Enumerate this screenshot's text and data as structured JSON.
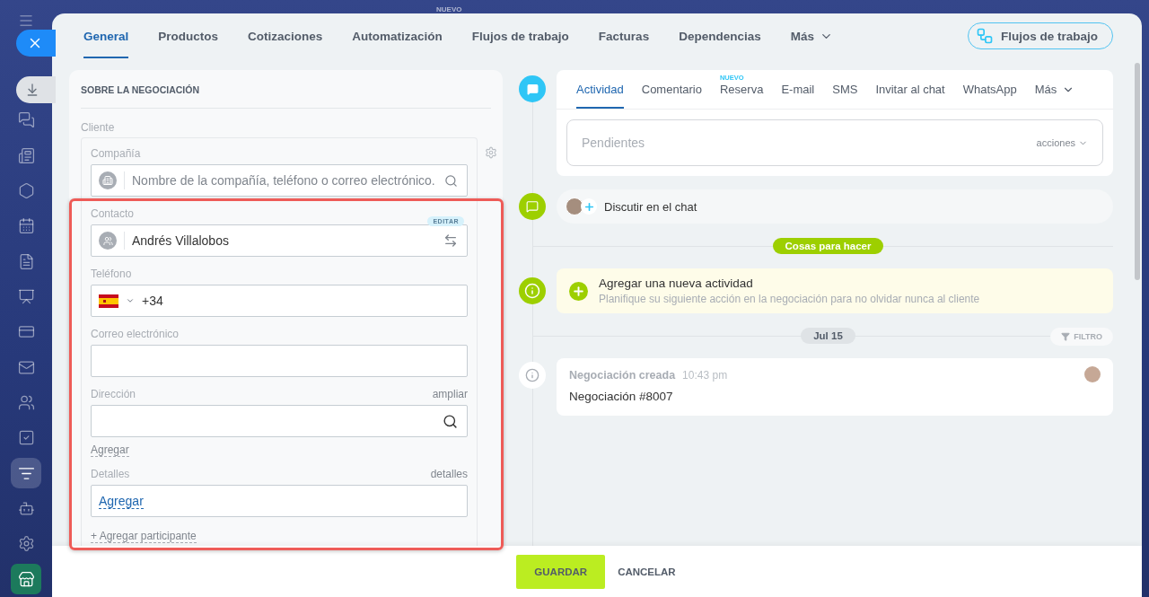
{
  "background": {
    "badge": "NUEVO"
  },
  "sidebar": {
    "items": [
      {
        "kind": "nav",
        "selected": false
      },
      {
        "kind": "nav",
        "selected": false
      },
      {
        "kind": "nav",
        "selected": false
      },
      {
        "kind": "nav",
        "selected": false
      },
      {
        "kind": "nav",
        "selected": false
      },
      {
        "kind": "nav",
        "selected": false
      },
      {
        "kind": "nav",
        "selected": false
      },
      {
        "kind": "nav",
        "selected": false
      },
      {
        "kind": "nav",
        "selected": false
      },
      {
        "kind": "nav",
        "selected": false
      },
      {
        "kind": "nav",
        "selected": true
      },
      {
        "kind": "nav",
        "selected": false
      },
      {
        "kind": "nav",
        "selected": false
      },
      {
        "kind": "app",
        "selected": false
      }
    ]
  },
  "tabs": [
    {
      "label": "General",
      "selected": true
    },
    {
      "label": "Productos",
      "selected": false
    },
    {
      "label": "Cotizaciones",
      "selected": false
    },
    {
      "label": "Automatización",
      "selected": false
    },
    {
      "label": "Flujos de trabajo",
      "selected": false
    },
    {
      "label": "Facturas",
      "selected": false
    },
    {
      "label": "Dependencias",
      "selected": false
    }
  ],
  "more_tab": "Más",
  "workflow_button": "Flujos de trabajo",
  "about": {
    "title": "SOBRE LA NEGOCIACIÓN",
    "client_label": "Cliente",
    "company": {
      "label": "Compañía",
      "placeholder": "Nombre de la compañía, teléfono o correo electrónico."
    },
    "contact": {
      "label": "Contacto",
      "value": "Andrés Villalobos",
      "badge": "EDITAR"
    },
    "phone": {
      "label": "Teléfono",
      "value": "+34"
    },
    "email": {
      "label": "Correo electrónico"
    },
    "address": {
      "label": "Dirección",
      "link": "ampliar"
    },
    "add_link": "Agregar",
    "details": {
      "label": "Detalles",
      "link": "detalles",
      "value": "Agregar"
    },
    "add_participant": "+ Agregar participante"
  },
  "activity": {
    "tabs": [
      {
        "label": "Actividad",
        "selected": true
      },
      {
        "label": "Comentario",
        "selected": false
      },
      {
        "label": "Reserva",
        "selected": false,
        "badge": "NUEVO"
      },
      {
        "label": "E-mail",
        "selected": false
      },
      {
        "label": "SMS",
        "selected": false
      },
      {
        "label": "Invitar al chat",
        "selected": false
      },
      {
        "label": "WhatsApp",
        "selected": false
      }
    ],
    "more_tab": "Más",
    "placeholder": "Pendientes",
    "actions": "acciones"
  },
  "discuss": "Discutir en el chat",
  "todo_label": "Cosas para hacer",
  "new_activity": {
    "title": "Agregar una nueva actividad",
    "subtitle": "Planifique su siguiente acción en la negociación para no olvidar nunca al cliente"
  },
  "date_label": "Jul 15",
  "filter": "FILTRO",
  "event": {
    "title": "Negociación creada",
    "time": "10:43 pm",
    "body": "Negociación #8007"
  },
  "footer": {
    "save": "GUARDAR",
    "cancel": "CANCELAR"
  }
}
